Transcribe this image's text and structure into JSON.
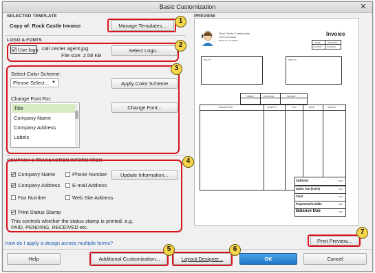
{
  "window": {
    "title": "Basic Customization",
    "close_glyph": "✕"
  },
  "template": {
    "header": "SELECTED TEMPLATE",
    "name": "Copy of: Rock Castle Invoice",
    "manage_button": "Manage Templates..."
  },
  "logo": {
    "header": "LOGO & FONTS",
    "checkbox_label": "Use logo",
    "checked": true,
    "file_name": "call center agent.jpg",
    "file_size": "File size: 2.58 KB",
    "select_button": "Select Logo..."
  },
  "color_scheme": {
    "label": "Select Color Scheme:",
    "value": "Please Select...",
    "apply_button": "Apply Color Scheme"
  },
  "fonts": {
    "label": "Change Font For:",
    "items": [
      "Title",
      "Company Name",
      "Company Address",
      "Labels"
    ],
    "selected_index": 0,
    "change_button": "Change Font..."
  },
  "company_info": {
    "header": "COMPANY & TRANSACTION INFORMATION",
    "options": [
      {
        "label": "Company Name",
        "checked": true
      },
      {
        "label": "Phone Number",
        "checked": false
      },
      {
        "label": "Company Address",
        "checked": true
      },
      {
        "label": "E-mail Address",
        "checked": false
      },
      {
        "label": "Fax Number",
        "checked": false
      },
      {
        "label": "Web Site Address",
        "checked": false
      }
    ],
    "update_button": "Update Information...",
    "status_stamp": {
      "label": "Print Status Stamp",
      "checked": true
    },
    "note_line1": "This controls whether the status stamp is printed. e.g.",
    "note_line2": "PAID, PENDING, RECEIVED etc."
  },
  "help_link": "How do I apply a design across multiple forms?",
  "preview": {
    "header": "PREVIEW",
    "company": {
      "line1": "Rock Castle Construction",
      "line2": "1735 County Road",
      "line3": "Bayshore, CA 94326"
    },
    "doc_title": "Invoice",
    "date_label": "DATE",
    "invoice_no_label": "INVOICE #",
    "date_value": "12/15/2023",
    "invoice_no_value": "E-INVOICE",
    "bill_to": "BILL TO",
    "ship_to": "SHIP TO",
    "terms": [
      "TERMS",
      "DUE DATE",
      "PROJECT"
    ],
    "columns": [
      "DESCRIPTION",
      "QUANTITY",
      "U/M",
      "RATE",
      "AMOUNT"
    ],
    "totals": [
      {
        "label": "Subtotal",
        "value": "0.00"
      },
      {
        "label": "Sales Tax (0.0%)",
        "value": "0.00"
      },
      {
        "label": "Total",
        "value": "0.00"
      },
      {
        "label": "Payments/Credits",
        "value": "0.00"
      },
      {
        "label": "Balance Due",
        "value": "0.00"
      }
    ],
    "print_preview_button": "Print Preview..."
  },
  "footer": {
    "help": "Help",
    "additional": "Additional Customization...",
    "layout": "Layout Designer...",
    "ok": "OK",
    "cancel": "Cancel"
  },
  "callouts": [
    "1",
    "2",
    "3",
    "4",
    "5",
    "6",
    "7"
  ],
  "colors": {
    "highlight": "#d8141d",
    "badge": "#f6d54a",
    "ok_button": "#2a86d6",
    "list_selection": "#d7ecc2",
    "link": "#1f5fb5"
  }
}
